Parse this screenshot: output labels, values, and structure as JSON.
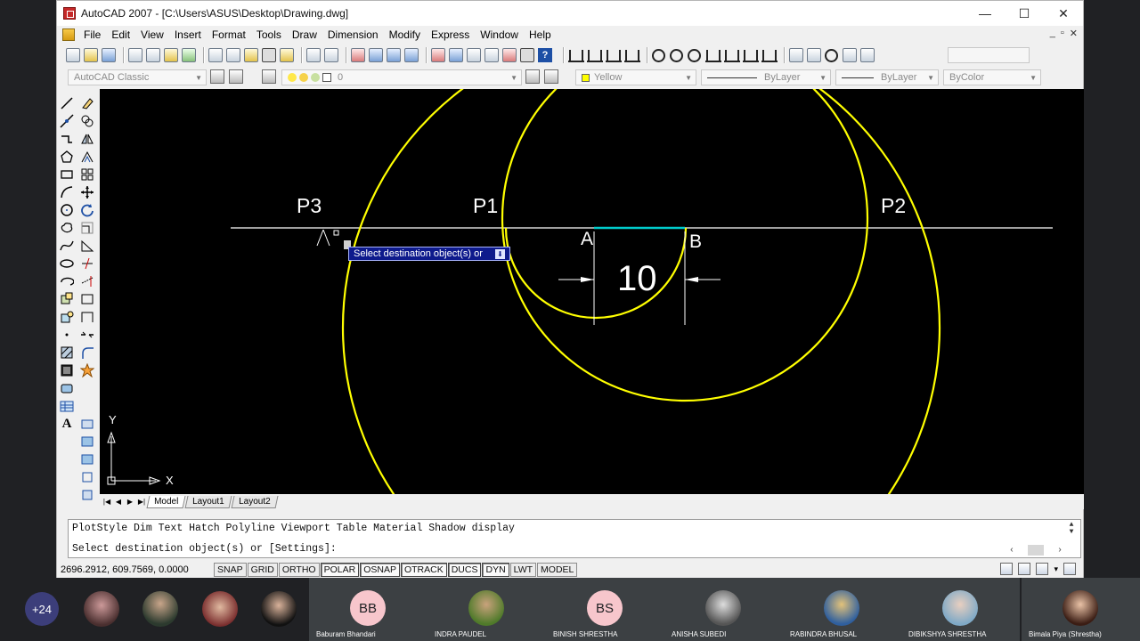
{
  "window": {
    "title": "AutoCAD 2007 - [C:\\Users\\ASUS\\Desktop\\Drawing.dwg]",
    "controls": {
      "minimize": "—",
      "maximize": "☐",
      "close": "✕"
    }
  },
  "menu": {
    "items": [
      "File",
      "Edit",
      "View",
      "Insert",
      "Format",
      "Tools",
      "Draw",
      "Dimension",
      "Modify",
      "Express",
      "Window",
      "Help"
    ],
    "doc_controls": {
      "minimize": "_",
      "restore": "▫",
      "close": "✕"
    }
  },
  "toolbar2": {
    "workspace": "AutoCAD Classic",
    "layer": "0",
    "color": "Yellow",
    "color_hex": "#ffff00",
    "linetype": "ByLayer",
    "lineweight": "ByLayer",
    "plotstyle": "ByColor"
  },
  "drawing": {
    "labels": {
      "p1": "P1",
      "p2": "P2",
      "p3": "P3",
      "a": "A",
      "b": "B",
      "dimension": "10"
    },
    "ucs": {
      "x": "X",
      "y": "Y"
    },
    "tooltip": "Select destination object(s) or",
    "colors": {
      "background": "#000000",
      "circle": "#ffff00",
      "segment": "#00cccc",
      "line": "#ffffff"
    }
  },
  "tabs": [
    "Model",
    "Layout1",
    "Layout2"
  ],
  "command": {
    "history": "PlotStyle Dim Text Hatch Polyline Viewport Table Material Shadow display",
    "prompt": "Select destination object(s) or [Settings]:"
  },
  "status": {
    "coords": "2696.2912, 609.7569, 0.0000",
    "buttons": [
      "SNAP",
      "GRID",
      "ORTHO",
      "POLAR",
      "OSNAP",
      "OTRACK",
      "DUCS",
      "DYN",
      "LWT",
      "MODEL"
    ]
  },
  "participants": {
    "more": "+24",
    "tiles": [
      {
        "initials": "BB",
        "name": "Baburam Bhandari",
        "color": "#f7c6cc"
      },
      {
        "initials": "",
        "name": "INDRA PAUDEL",
        "color": "#6b8f3a"
      },
      {
        "initials": "BS",
        "name": "BINISH SHRESTHA",
        "color": "#f7c6cc"
      },
      {
        "initials": "",
        "name": "ANISHA SUBEDI",
        "color": "#8a8a8a"
      },
      {
        "initials": "",
        "name": "RABINDRA BHUSAL",
        "color": "#2f5f9e"
      },
      {
        "initials": "",
        "name": "DIBIKSHYA SHRESTHA",
        "color": "#c6dbe8"
      },
      {
        "initials": "",
        "name": "Bimala Piya (Shrestha)",
        "color": "#8a4b3a"
      }
    ]
  }
}
